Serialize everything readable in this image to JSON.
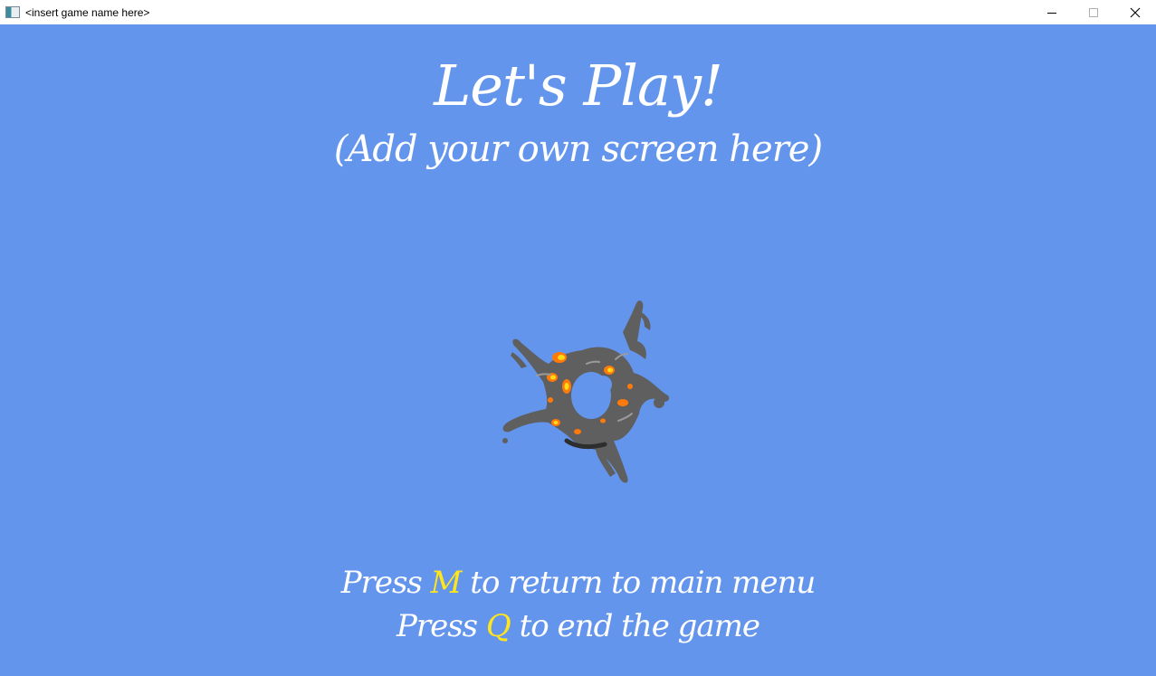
{
  "window": {
    "title": "<insert game name here>"
  },
  "screen": {
    "title": "Let's Play!",
    "subtitle": "(Add your own screen here)",
    "instructions": [
      {
        "prefix": "Press ",
        "key": "M",
        "suffix": " to return to main menu"
      },
      {
        "prefix": "Press ",
        "key": "Q",
        "suffix": " to end the game"
      }
    ]
  },
  "colors": {
    "background": "#6495ed",
    "text": "#ffffff",
    "key_highlight": "#ffe51a",
    "smoke": "#5f5f5f",
    "fire": "#ff7a0a"
  },
  "icons": {
    "sprite": "explosion-icon"
  }
}
